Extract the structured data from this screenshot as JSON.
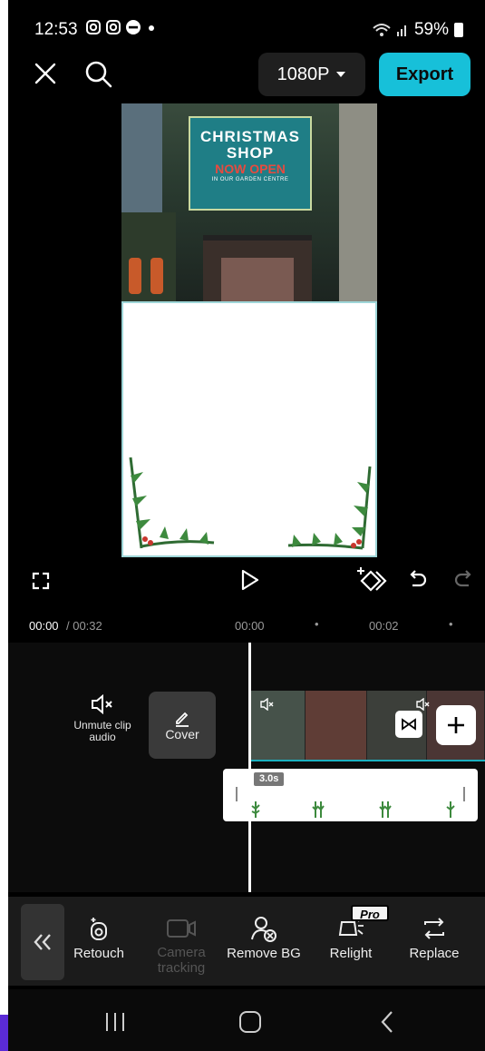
{
  "status": {
    "time": "12:53",
    "battery": "59%",
    "notification_icons": [
      "instagram-icon",
      "instagram-icon",
      "dnd-icon",
      "dot-icon"
    ]
  },
  "topbar": {
    "resolution": "1080P",
    "export_label": "Export"
  },
  "preview": {
    "sign_line1": "CHRISTMAS",
    "sign_line2": "SHOP",
    "sign_line3": "NOW OPEN",
    "sign_line4": "IN OUR GARDEN CENTRE"
  },
  "timeline": {
    "current_time": "00:00",
    "total_time": "/ 00:32",
    "ruler_labels": [
      "00:00",
      "00:02"
    ],
    "unmute_label": "Unmute clip audio",
    "cover_label": "Cover",
    "sticker_duration": "3.0s"
  },
  "toolbar": {
    "items": [
      {
        "label": "Retouch",
        "icon": "retouch-icon"
      },
      {
        "label": "Camera tracking",
        "icon": "camera-tracking-icon"
      },
      {
        "label": "Remove BG",
        "icon": "remove-bg-icon"
      },
      {
        "label": "Relight",
        "icon": "relight-icon"
      },
      {
        "label": "Replace",
        "icon": "replace-icon"
      }
    ],
    "pro_badge": "Pro"
  },
  "colors": {
    "accent": "#17c0d9",
    "background": "#000000",
    "toolbar": "#1b1b1b"
  }
}
